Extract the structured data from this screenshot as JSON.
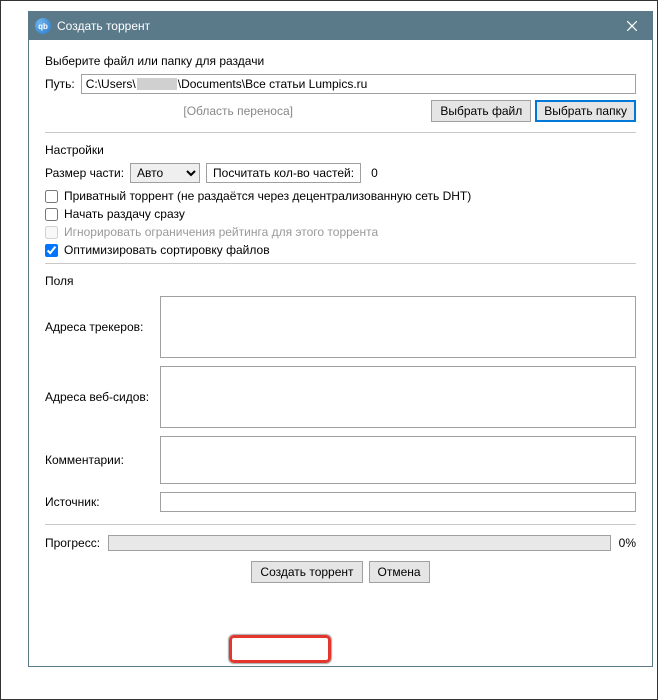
{
  "titlebar": {
    "app_icon_text": "qb",
    "title": "Создать торрент"
  },
  "file_section": {
    "heading": "Выберите файл или папку для раздачи",
    "path_label": "Путь:",
    "path_value_prefix": "C:\\Users\\",
    "path_value_suffix": "\\Documents\\Все статьи Lumpics.ru",
    "drop_hint": "[Область переноса]",
    "select_file_btn": "Выбрать файл",
    "select_folder_btn": "Выбрать папку"
  },
  "settings": {
    "heading": "Настройки",
    "piece_size_label": "Размер части:",
    "piece_size_value": "Авто",
    "count_pieces_btn": "Посчитать кол-во частей:",
    "piece_count": "0",
    "private_torrent": "Приватный торрент (не раздаётся через децентрализованную сеть DHT)",
    "start_seeding": "Начать раздачу сразу",
    "ignore_ratio": "Игнорировать ограничения рейтинга для этого торрента",
    "optimize_sort": "Оптимизировать сортировку файлов"
  },
  "fields": {
    "heading": "Поля",
    "trackers_label": "Адреса трекеров:",
    "webseeds_label": "Адреса веб-сидов:",
    "comments_label": "Комментарии:",
    "source_label": "Источник:"
  },
  "progress": {
    "label": "Прогресс:",
    "percent": "0%"
  },
  "buttons": {
    "create": "Создать торрент",
    "cancel": "Отмена"
  }
}
